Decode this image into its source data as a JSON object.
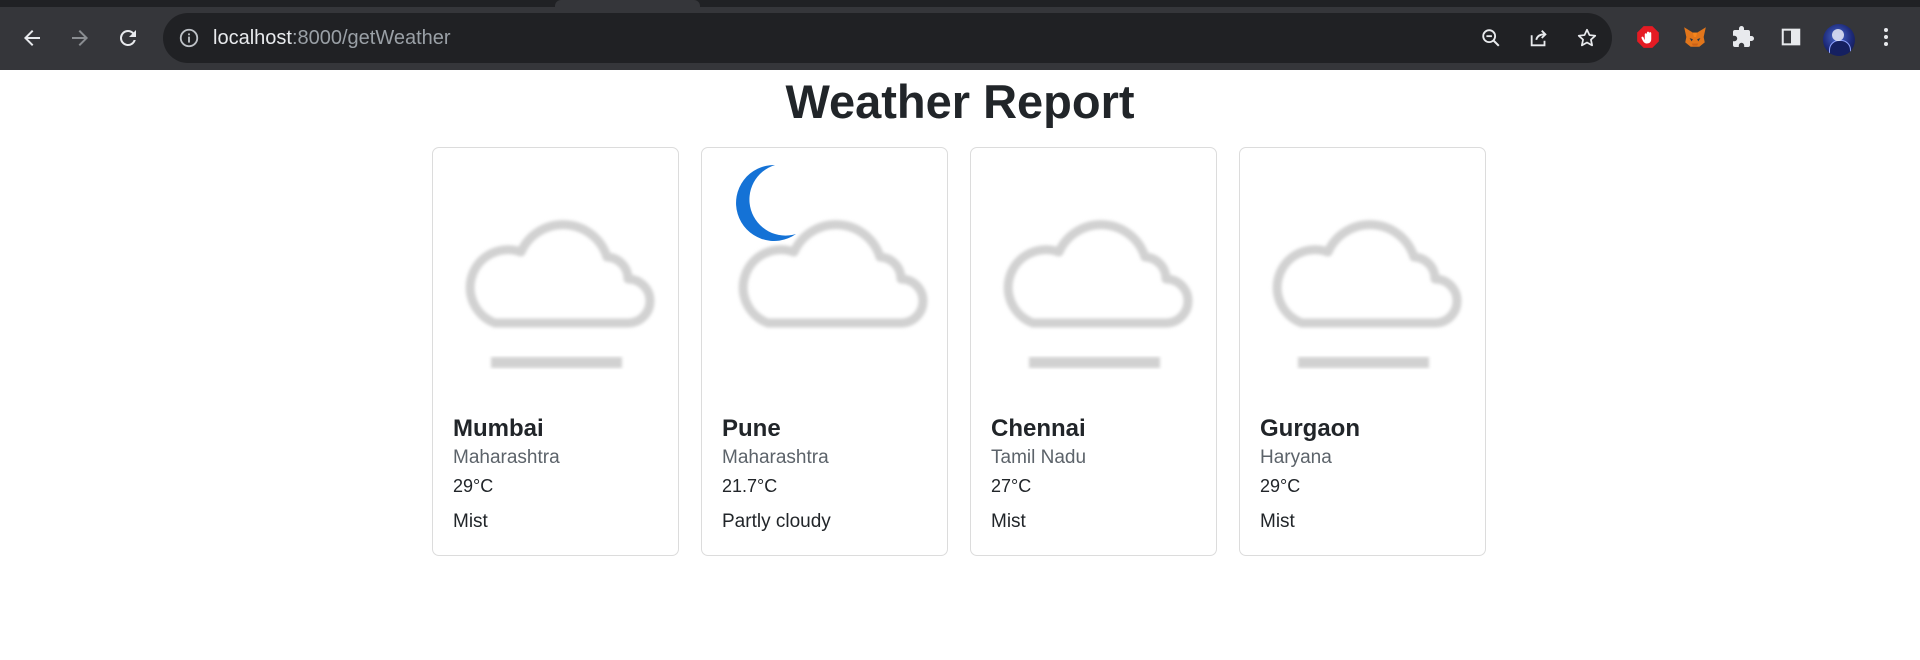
{
  "browser": {
    "url_host": "localhost",
    "url_path": ":8000/getWeather",
    "icons": {
      "back": "arrow-left-icon",
      "forward": "arrow-right-icon",
      "reload": "reload-icon",
      "site_info": "info-icon",
      "zoom": "zoom-out-icon",
      "share": "share-icon",
      "bookmark": "star-icon",
      "extensions": [
        "adblock-icon",
        "metamask-fox-icon",
        "puzzle-icon"
      ],
      "side_panel": "side-panel-icon",
      "menu": "kebab-menu-icon"
    },
    "colors": {
      "toolbar": "#35363a",
      "omnibox": "#202124",
      "tabstrip": "#202124"
    }
  },
  "page": {
    "title": "Weather Report"
  },
  "cards": [
    {
      "city": "Mumbai",
      "state": "Maharashtra",
      "temp": "29°C",
      "condition": "Mist",
      "icon": "mist-icon"
    },
    {
      "city": "Pune",
      "state": "Maharashtra",
      "temp": "21.7°C",
      "condition": "Partly cloudy",
      "icon": "partly-cloudy-night-icon"
    },
    {
      "city": "Chennai",
      "state": "Tamil Nadu",
      "temp": "27°C",
      "condition": "Mist",
      "icon": "mist-icon"
    },
    {
      "city": "Gurgaon",
      "state": "Haryana",
      "temp": "29°C",
      "condition": "Mist",
      "icon": "mist-icon"
    }
  ]
}
